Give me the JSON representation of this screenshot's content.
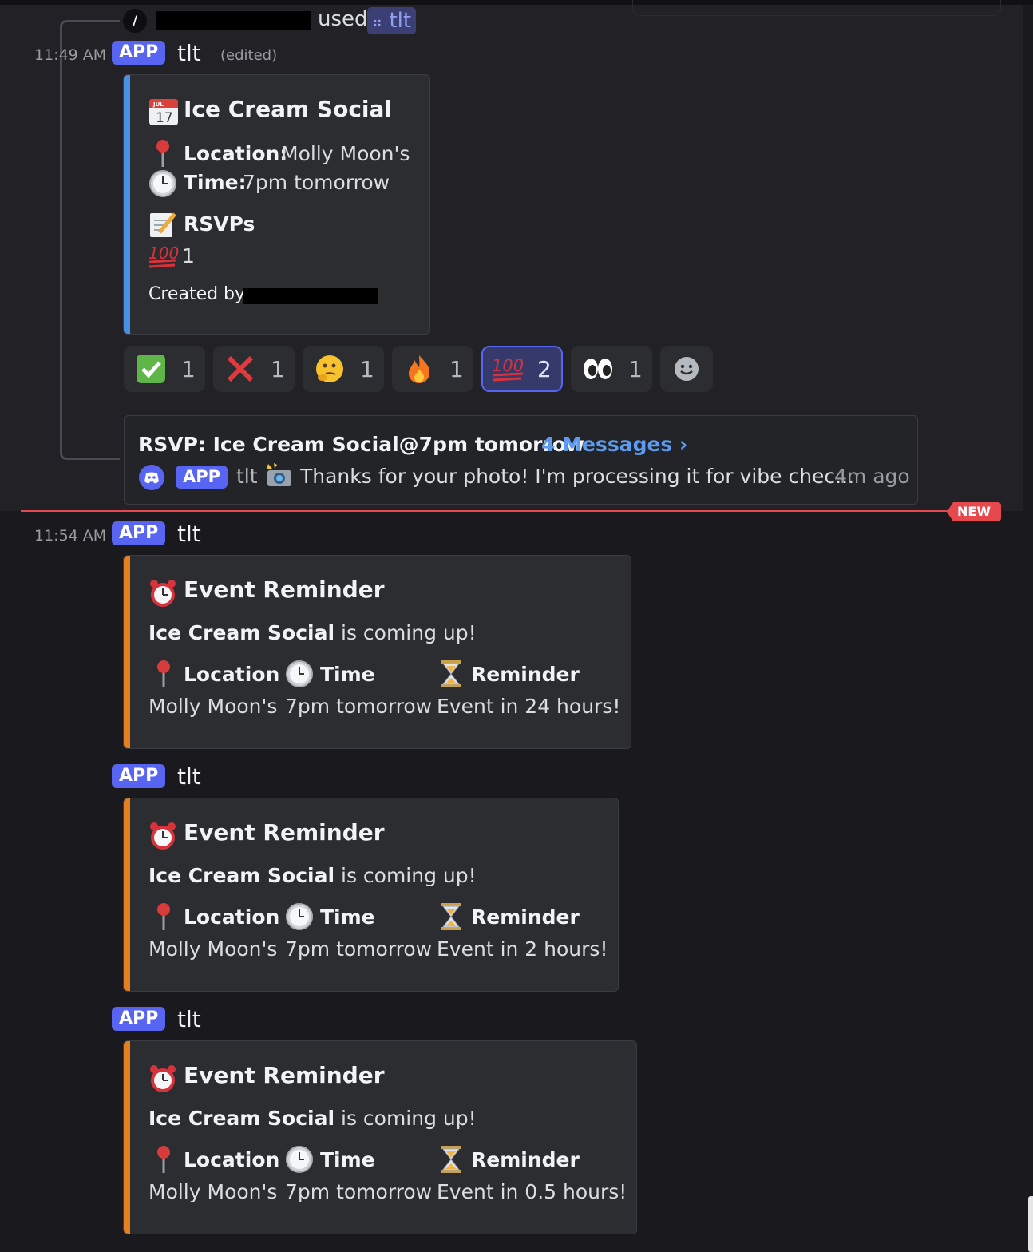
{
  "colors": {
    "accent": "#5865f2",
    "rsvp_bar": "#4a90e2",
    "reminder_bar": "#e67e22",
    "new_divider": "#e5484d",
    "link": "#5c9bf0"
  },
  "command_header": {
    "icon": "slash-icon",
    "used_text": "used",
    "command_mention": "tlt"
  },
  "message1": {
    "timestamp": "11:49 AM",
    "badge": "APP",
    "author": "tlt",
    "edited": "(edited)",
    "embed": {
      "title_icon": "calendar-icon",
      "title": "Ice Cream Social",
      "location_label": "Location:",
      "location_value": "Molly Moon's",
      "time_label": "Time:",
      "time_value": "7pm tomorrow",
      "rsvps_label": "RSVPs",
      "rsvp_count": "1",
      "created_by": "Created by"
    },
    "reactions": [
      {
        "icon": "check-mark-icon",
        "count": "1",
        "active": false
      },
      {
        "icon": "cross-mark-icon",
        "count": "1",
        "active": false
      },
      {
        "icon": "thinking-face-icon",
        "count": "1",
        "active": false
      },
      {
        "icon": "fire-icon",
        "count": "1",
        "active": false
      },
      {
        "icon": "hundred-points-icon",
        "count": "2",
        "active": true
      },
      {
        "icon": "eyes-icon",
        "count": "1",
        "active": false
      }
    ],
    "add_reaction_icon": "add-reaction-icon",
    "thread": {
      "title": "RSVP: Ice Cream Social@7pm tomorrow",
      "link": "4 Messages ›",
      "badge": "APP",
      "author": "tlt",
      "preview": "Thanks for your photo! I'm processing it for vibe chec...",
      "time": "4m ago"
    }
  },
  "new_divider": "NEW",
  "message2": {
    "timestamp": "11:54 AM",
    "badge": "APP",
    "author": "tlt"
  },
  "reminders": [
    {
      "badge": "APP",
      "author": "tlt",
      "title": "Event Reminder",
      "event_name": "Ice Cream Social",
      "coming_up": "is coming up!",
      "location_label": "Location",
      "location_value": "Molly Moon's",
      "time_label": "Time",
      "time_value": "7pm tomorrow",
      "reminder_label": "Reminder",
      "reminder_value": "Event in 24 hours!"
    },
    {
      "badge": "APP",
      "author": "tlt",
      "title": "Event Reminder",
      "event_name": "Ice Cream Social",
      "coming_up": "is coming up!",
      "location_label": "Location",
      "location_value": "Molly Moon's",
      "time_label": "Time",
      "time_value": "7pm tomorrow",
      "reminder_label": "Reminder",
      "reminder_value": "Event in 2 hours!"
    },
    {
      "badge": "APP",
      "author": "tlt",
      "title": "Event Reminder",
      "event_name": "Ice Cream Social",
      "coming_up": "is coming up!",
      "location_label": "Location",
      "location_value": "Molly Moon's",
      "time_label": "Time",
      "time_value": "7pm tomorrow",
      "reminder_label": "Reminder",
      "reminder_value": "Event in 0.5 hours!"
    }
  ]
}
